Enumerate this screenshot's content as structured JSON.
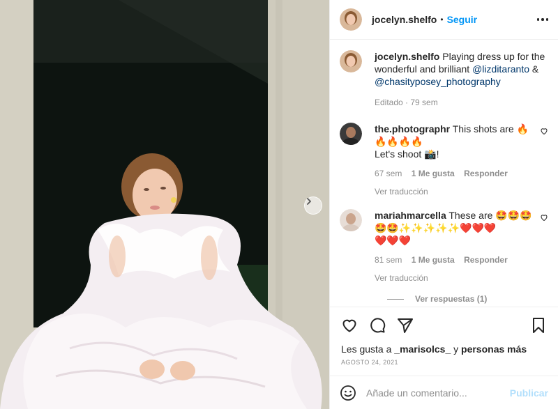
{
  "post": {
    "username": "jocelyn.shelfo",
    "separator": "•",
    "follow_label": "Seguir"
  },
  "caption": {
    "username": "jocelyn.shelfo",
    "text_1": "Playing dress up for the wonderful and brilliant",
    "mention_1": "@lizditaranto",
    "text_2": "&",
    "mention_2": "@chasityposey_photography",
    "meta": "Editado · 79 sem"
  },
  "comments": [
    {
      "username": "the.photographr",
      "text_1": "This shots are 🔥",
      "text_2": "🔥🔥🔥🔥",
      "text_3": "Let's shoot 📸!",
      "time": "67 sem",
      "likes": "1 Me gusta",
      "reply": "Responder",
      "translate": "Ver traducción"
    },
    {
      "username": "mariahmarcella",
      "text_1": "These are 🤩🤩🤩",
      "text_2": "🤩🤩✨✨✨✨✨❤️❤️❤️",
      "text_3": "❤️❤️❤️",
      "time": "81 sem",
      "likes": "1 Me gusta",
      "reply": "Responder",
      "translate": "Ver traducción",
      "view_replies": "Ver respuestas (1)"
    }
  ],
  "likes": {
    "prefix": "Les gusta a",
    "user": "_marisolcs_",
    "middle": "y",
    "others": "personas más"
  },
  "date": "AGOSTO 24, 2021",
  "add_comment": {
    "placeholder": "Añade un comentario...",
    "publish_label": "Publicar"
  },
  "icons": {
    "like": "heart-icon",
    "comment": "comment-icon",
    "share": "paper-plane-icon",
    "save": "bookmark-icon",
    "emoji": "smiley-icon",
    "more": "more-dots-icon",
    "next": "chevron-right-icon"
  },
  "colors": {
    "link": "#0095f6",
    "mention": "#00376b",
    "muted": "#8e8e8e",
    "publish_disabled": "#b2dffc"
  }
}
